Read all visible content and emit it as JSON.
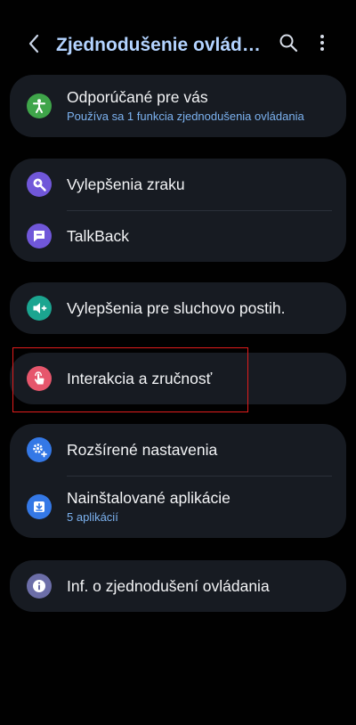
{
  "header": {
    "title": "Zjednodušenie ovládania",
    "back_icon": "back-arrow-icon",
    "search_icon": "search-icon",
    "more_icon": "more-vertical-icon",
    "accent_color": "#b3d3ff"
  },
  "cards": [
    {
      "items": [
        {
          "title": "Odporúčané pre vás",
          "subtitle": "Používa sa 1 funkcia zjednodušenia ovládania",
          "icon": "accessibility-person-icon",
          "icon_color": "#3fa54a"
        }
      ]
    },
    {
      "items": [
        {
          "title": "Vylepšenia zraku",
          "icon": "magnifier-plus-icon",
          "icon_color": "#7057d9"
        },
        {
          "title": "TalkBack",
          "icon": "talkback-speech-icon",
          "icon_color": "#7057d9"
        }
      ]
    },
    {
      "items": [
        {
          "title": "Vylepšenia pre sluchovo postih.",
          "icon": "hearing-speaker-icon",
          "icon_color": "#1ba590"
        }
      ]
    },
    {
      "items": [
        {
          "title": "Interakcia a zručnosť",
          "icon": "touch-hand-icon",
          "icon_color": "#e6566c"
        }
      ]
    },
    {
      "items": [
        {
          "title": "Rozšírené nastavenia",
          "icon": "gears-plus-icon",
          "icon_color": "#3478e6"
        },
        {
          "title": "Nainštalované aplikácie",
          "subtitle": "5 aplikácií",
          "icon": "download-tray-icon",
          "icon_color": "#3478e6"
        }
      ]
    },
    {
      "items": [
        {
          "title": "Inf. o zjednodušení ovládania",
          "icon": "info-icon",
          "icon_color": "#6c6ea8"
        }
      ]
    }
  ],
  "colors": {
    "background": "#010101",
    "card": "#171b22",
    "subtitle": "#7cb2f0",
    "highlight_box": "#e21c1c"
  }
}
